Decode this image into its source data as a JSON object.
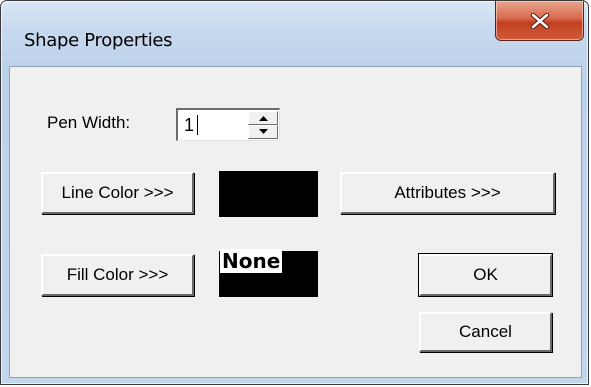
{
  "window": {
    "title": "Shape Properties",
    "close_label": "X"
  },
  "pen_width": {
    "label": "Pen Width:",
    "value": "1"
  },
  "buttons": {
    "line_color": "Line Color >>>",
    "attributes": "Attributes >>>",
    "fill_color": "Fill Color >>>",
    "ok": "OK",
    "cancel": "Cancel"
  },
  "swatches": {
    "line_color": "#000000",
    "fill_color": "#000000",
    "fill_label": "None"
  },
  "colors": {
    "client_bg": "#f0f0f0",
    "close_button": "#c2401f",
    "frame": "#c7d9ee"
  },
  "icons": {
    "close": "close-icon",
    "spin_up": "arrow-up-icon",
    "spin_down": "arrow-down-icon"
  }
}
